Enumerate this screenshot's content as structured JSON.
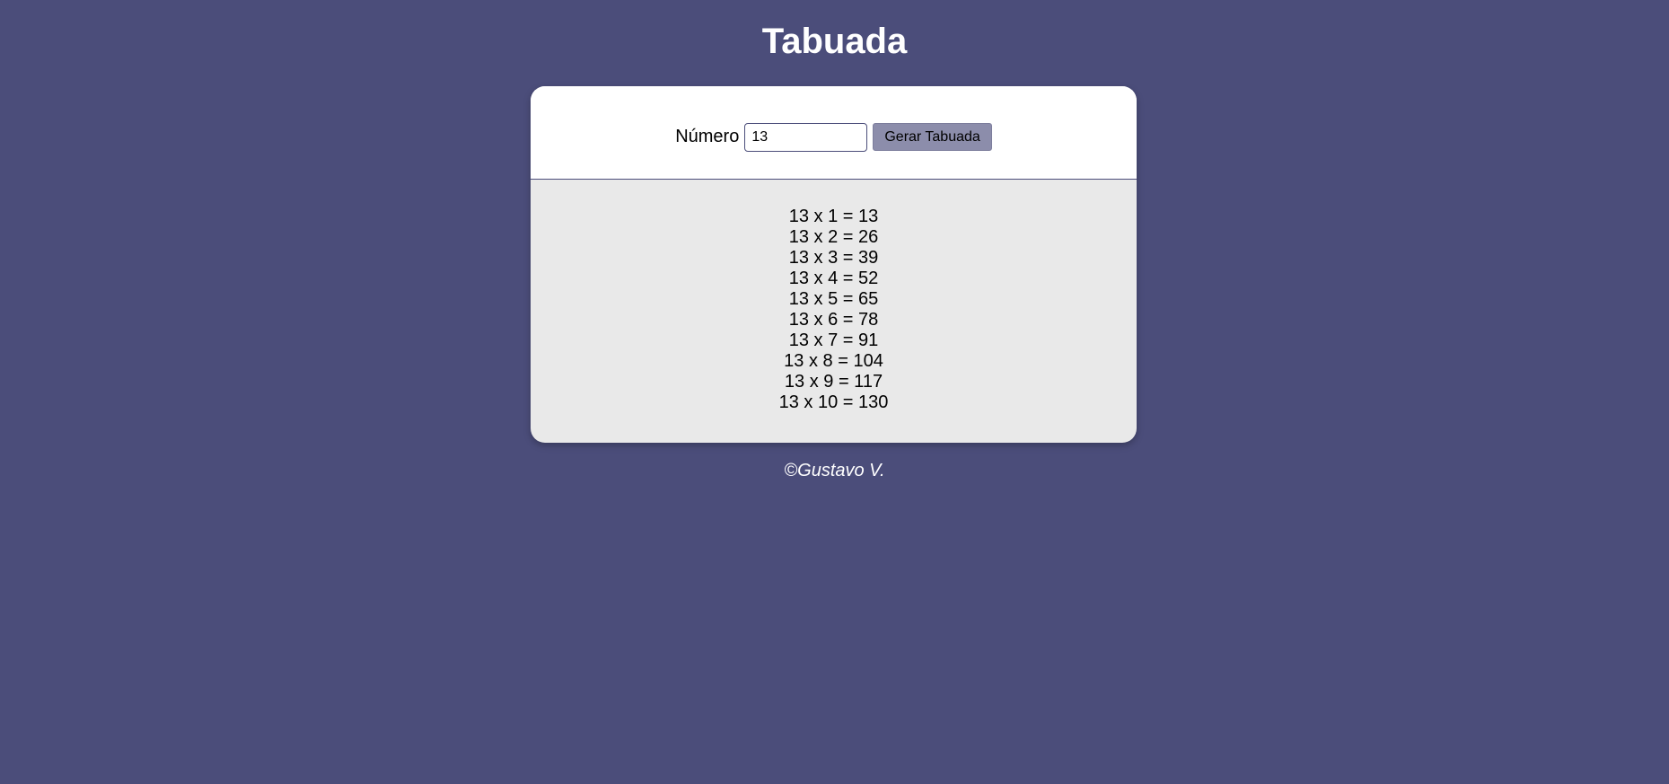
{
  "header": {
    "title": "Tabuada"
  },
  "form": {
    "label": "Número",
    "input_value": "13",
    "button_label": "Gerar Tabuada"
  },
  "results": [
    "13 x 1 = 13",
    "13 x 2 = 26",
    "13 x 3 = 39",
    "13 x 4 = 52",
    "13 x 5 = 65",
    "13 x 6 = 78",
    "13 x 7 = 91",
    "13 x 8 = 104",
    "13 x 9 = 117",
    "13 x 10 = 130"
  ],
  "footer": {
    "text": "©Gustavo V."
  },
  "colors": {
    "background": "#4b4d7a",
    "card_results_bg": "#e9e9e9",
    "button_bg": "#8c8dab"
  }
}
